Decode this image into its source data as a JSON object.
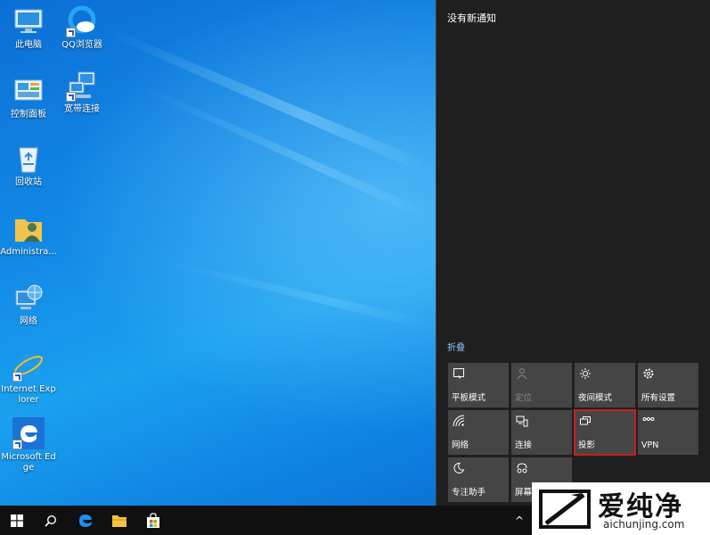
{
  "desktop": {
    "icons": [
      {
        "label": "此电脑"
      },
      {
        "label": "QQ浏览器"
      },
      {
        "label": "控制面板"
      },
      {
        "label": "宽带连接"
      },
      {
        "label": "回收站"
      },
      {
        "label": "Administra..."
      },
      {
        "label": "网络"
      },
      {
        "label": "Internet Explorer"
      },
      {
        "label": "Microsoft Edge"
      }
    ]
  },
  "action_center": {
    "no_notifications": "没有新通知",
    "collapse": "折叠",
    "tiles": [
      {
        "label": "平板模式",
        "icon": "tablet-mode-icon"
      },
      {
        "label": "定位",
        "icon": "location-icon"
      },
      {
        "label": "夜间模式",
        "icon": "night-light-icon"
      },
      {
        "label": "所有设置",
        "icon": "settings-gear-icon"
      },
      {
        "label": "网络",
        "icon": "wifi-icon"
      },
      {
        "label": "连接",
        "icon": "connect-icon"
      },
      {
        "label": "投影",
        "icon": "project-icon"
      },
      {
        "label": "VPN",
        "icon": "vpn-icon"
      },
      {
        "label": "专注助手",
        "icon": "focus-assist-icon"
      },
      {
        "label": "屏幕截",
        "icon": "screen-snip-icon"
      }
    ],
    "highlight_color": "#c81e1e"
  },
  "taskbar": {
    "tray_arrow": "^"
  },
  "watermark": {
    "cn": "爱纯净",
    "en": "aichunjing.com"
  }
}
